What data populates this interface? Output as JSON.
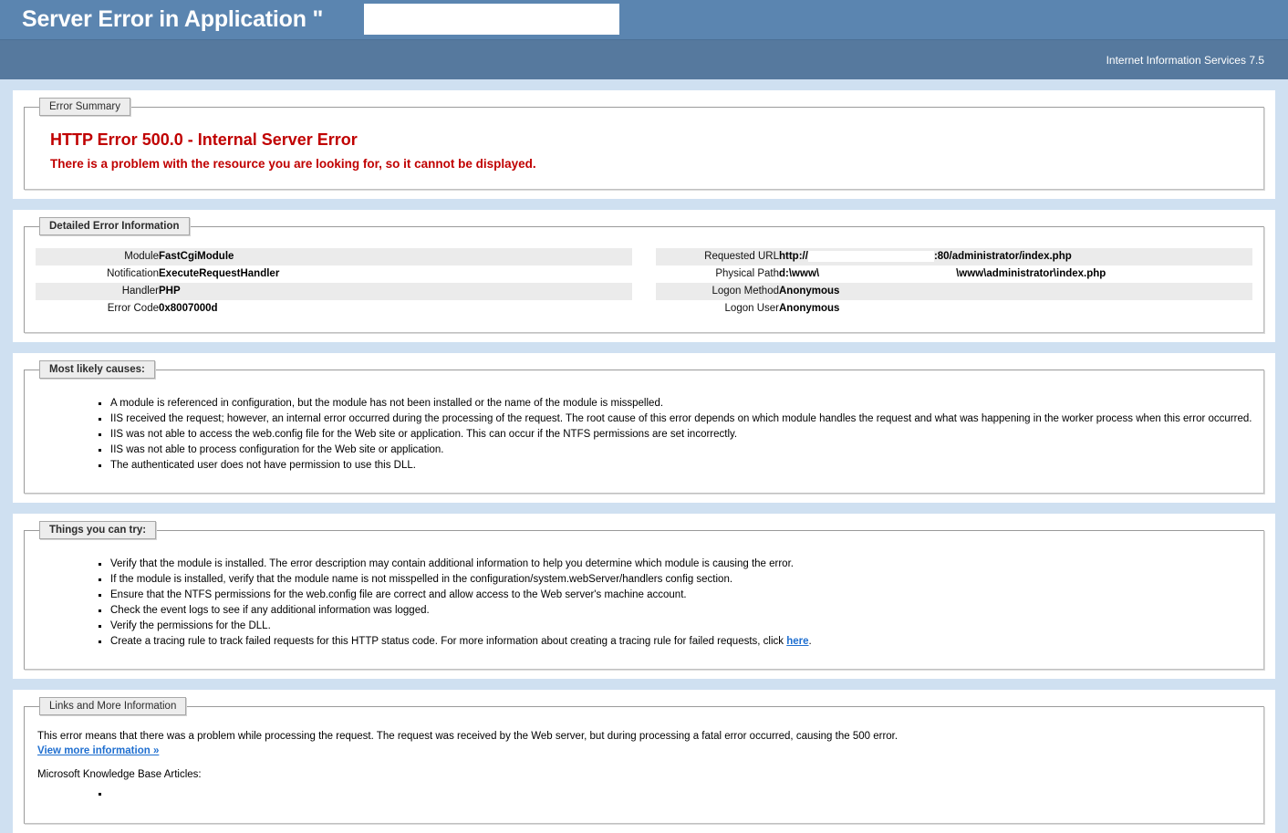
{
  "header": {
    "title_prefix": "Server Error in Application \"",
    "title_suffix": "\"",
    "application_name_redacted": "",
    "server_product": "Internet Information Services 7.5",
    "bar_color": "#5b85b0",
    "sub_bar_color": "#56799e"
  },
  "page": {
    "background_color": "#cfe0f1",
    "panel_background": "#ffffff",
    "error_text_color": "#c00000",
    "link_color": "#1f6fd0",
    "row_alt_color": "#ebebeb"
  },
  "error_summary": {
    "legend": "Error Summary",
    "heading": "HTTP Error 500.0 - Internal Server Error",
    "subheading": "There is a problem with the resource you are looking for, so it cannot be displayed."
  },
  "detailed_error": {
    "legend": "Detailed Error Information",
    "left_rows": [
      {
        "label": "Module",
        "value": "FastCgiModule"
      },
      {
        "label": "Notification",
        "value": "ExecuteRequestHandler"
      },
      {
        "label": "Handler",
        "value": "PHP"
      },
      {
        "label": "Error Code",
        "value": "0x8007000d"
      }
    ],
    "right_rows": [
      {
        "label": "Requested URL",
        "value_before": "http://",
        "value_after": ":80/administrator/index.php",
        "redacted": true
      },
      {
        "label": "Physical Path",
        "value_before": "d:\\www\\",
        "value_after": "\\www\\administrator\\index.php",
        "redacted": true
      },
      {
        "label": "Logon Method",
        "value": "Anonymous"
      },
      {
        "label": "Logon User",
        "value": "Anonymous"
      }
    ]
  },
  "most_likely_causes": {
    "legend": "Most likely causes:",
    "items": [
      "A module is referenced in configuration, but the module has not been installed or the name of the module is misspelled.",
      "IIS received the request; however, an internal error occurred during the processing of the request. The root cause of this error depends on which module handles the request and what was happening in the worker process when this error occurred.",
      "IIS was not able to access the web.config file for the Web site or application. This can occur if the NTFS permissions are set incorrectly.",
      "IIS was not able to process configuration for the Web site or application.",
      "The authenticated user does not have permission to use this DLL."
    ]
  },
  "things_you_can_try": {
    "legend": "Things you can try:",
    "items": [
      "Verify that the module is installed. The error description may contain additional information to help you determine which module is causing the error.",
      "If the module is installed, verify that the module name is not misspelled in the configuration/system.webServer/handlers config section.",
      "Ensure that the NTFS permissions for the web.config file are correct and allow access to the Web server's machine account.",
      "Check the event logs to see if any additional information was logged.",
      "Verify the permissions for the DLL."
    ],
    "last_item_before_link": "Create a tracing rule to track failed requests for this HTTP status code. For more information about creating a tracing rule for failed requests, click ",
    "last_item_link": "here",
    "last_item_after_link": "."
  },
  "links_more_info": {
    "legend": "Links and More Information",
    "paragraph": "This error means that there was a problem while processing the request. The request was received by the Web server, but during processing a fatal error occurred, causing the 500 error.",
    "view_more_link": "View more information »",
    "kb_label": "Microsoft Knowledge Base Articles:",
    "kb_items": [
      ""
    ]
  }
}
